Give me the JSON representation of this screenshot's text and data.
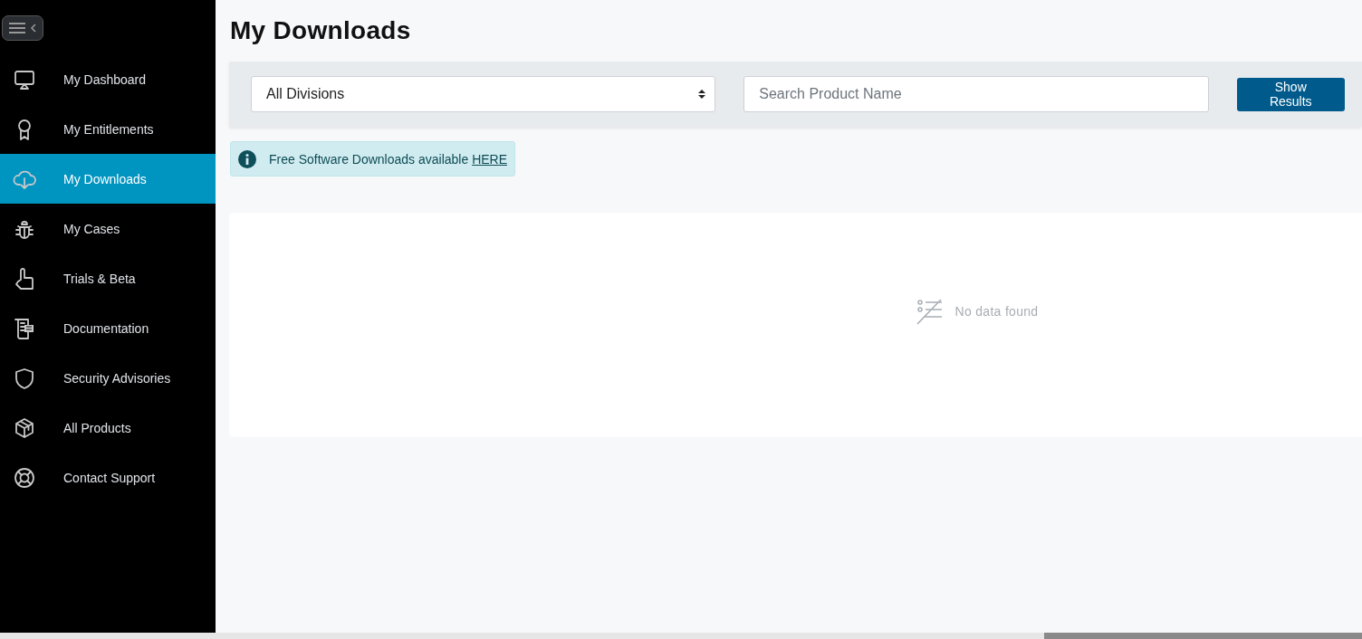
{
  "sidebar": {
    "items": [
      {
        "label": "My Dashboard",
        "selected": false
      },
      {
        "label": "My Entitlements",
        "selected": false
      },
      {
        "label": "My Downloads",
        "selected": true
      },
      {
        "label": "My Cases",
        "selected": false
      },
      {
        "label": "Trials & Beta",
        "selected": false
      },
      {
        "label": "Documentation",
        "selected": false
      },
      {
        "label": "Security Advisories",
        "selected": false
      },
      {
        "label": "All Products",
        "selected": false
      },
      {
        "label": "Contact Support",
        "selected": false
      }
    ]
  },
  "page_title": "My Downloads",
  "filters": {
    "division": {
      "value": "All Divisions"
    },
    "search": {
      "placeholder": "Search Product Name"
    },
    "button": "Show Results"
  },
  "alert": {
    "text": "Free Software Downloads available ",
    "link": "HERE"
  },
  "results": {
    "empty_message": "No data found"
  }
}
